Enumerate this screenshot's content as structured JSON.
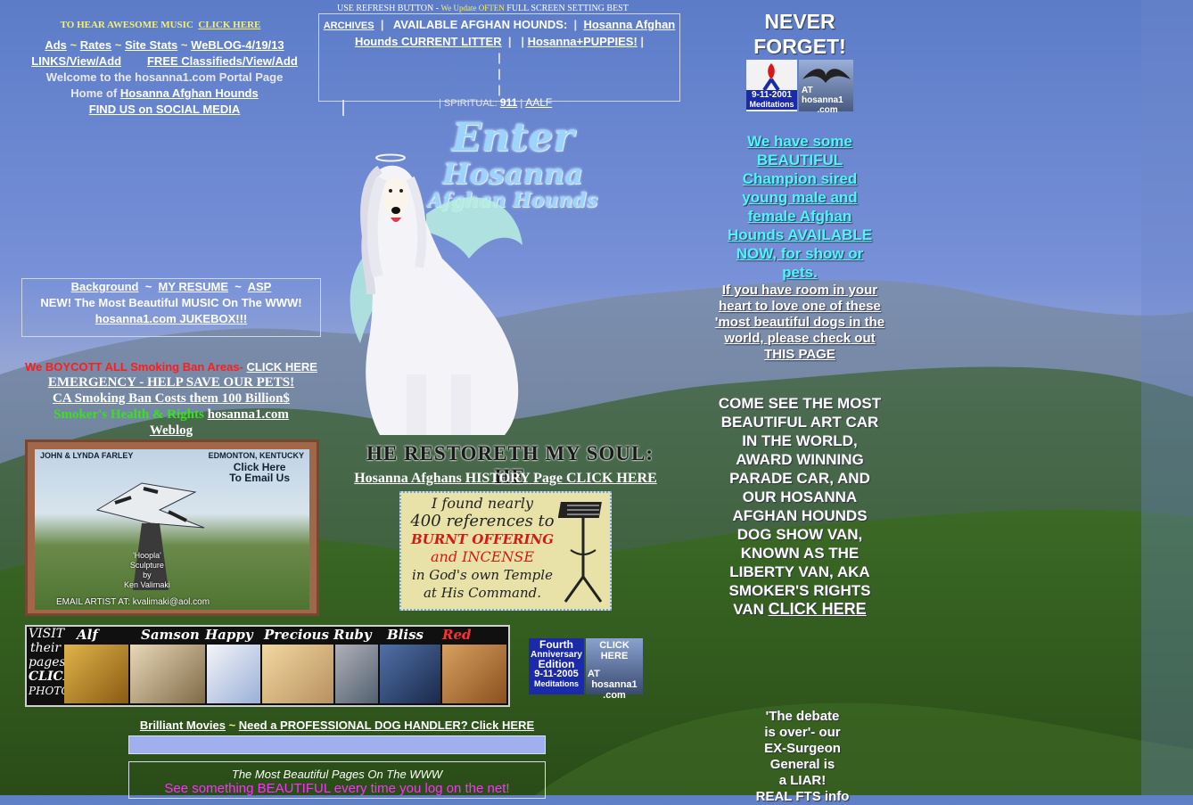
{
  "top": {
    "refresh_notice": "USE  REFRESH BUTTON -",
    "refresh_update": "We Update OFTEN",
    "refresh_tail": "FULL SCREEN SETTING BEST",
    "music_prompt": "TO HEAR AWESOME MUSIC",
    "music_link": "CLICK HERE"
  },
  "left_nav": {
    "ads": "Ads",
    "rates": "Rates",
    "site_stats": "Site Stats",
    "weblog": "WeBLOG-4/19/13",
    "links": "LINKS/View/Add",
    "classifieds": "FREE Classifieds/View/Add",
    "welcome": "Welcome to the hosanna1.com Portal Page",
    "home_of": "Home of",
    "home_link": "Hosanna Afghan Hounds",
    "social": "FIND US on SOCIAL MEDIA",
    "sep": "~"
  },
  "center_box": {
    "archives": "ARCHIVES",
    "available": "AVAILABLE AFGHAN HOUNDS:",
    "hosanna_current": "Hosanna Afghan Hounds CURRENT LITTER",
    "puppies": "Hosanna+PUPPIES!",
    "spiritual": "SPIRITUAL:",
    "link_911": "911",
    "aalf": "AALF"
  },
  "enter_logo": {
    "line1": "Enter",
    "line2": "Hosanna",
    "line3": "Afghan Hounds"
  },
  "restoreth": "HE RESTORETH MY SOUL: HE",
  "history_link": "Hosanna Afghans HISTORY Page CLICK HERE",
  "burnt_offering": {
    "l1": "I found nearly",
    "l2": "400 references to",
    "l3": "BURNT OFFERING",
    "l4": "and INCENSE",
    "l5": "in God's own Temple",
    "l6": "at His Command."
  },
  "left_box": {
    "background": "Background",
    "resume": "MY RESUME",
    "asp": "ASP",
    "music": "NEW! The Most Beautiful MUSIC On The WWW!",
    "jukebox": "hosanna1.com JUKEBOX!!!"
  },
  "boycott": {
    "text": "We BOYCOTT ALL Smoking Ban Areas-",
    "link": "CLICK HERE",
    "emergency": "EMERGENCY - HELP SAVE OUR PETS!",
    "ca_ban": "CA Smoking Ban Costs them 100 Billion$",
    "smokers": "Smoker's Health & Rights",
    "hosanna_link": "hosanna1.com",
    "weblog": "Weblog"
  },
  "farley_card": {
    "names": "JOHN & LYNDA FARLEY",
    "location": "EDMONTON, KENTUCKY",
    "click": "Click Here",
    "email": "To Email Us",
    "hoopla": "'Hoopla'",
    "sculpture": "Sculpture",
    "by": "by",
    "artist": "Ken Valimaki",
    "email_artist": "EMAIL ARTIST AT:  kvalimaki@aol.com"
  },
  "dog_strip": {
    "visit": "VISIT",
    "their": "their",
    "pages": "pages",
    "click": "CLICK",
    "photos": "PHOTOS",
    "names": [
      "Alf",
      "Samson",
      "Happy",
      "Precious",
      "Ruby",
      "Bliss",
      "Red Man"
    ]
  },
  "anniversary": {
    "l1": "Fourth",
    "l2": "Anniversary",
    "l3": "Edition",
    "l4": "9-11-2005",
    "l5": "Meditations",
    "click": "CLICK HERE",
    "at": "AT",
    "site": "hosanna1",
    "com": ".com"
  },
  "bottom": {
    "movies": "Brilliant Movies",
    "handler": "Need a PROFESSIONAL DOG HANDLER? Click HERE",
    "sep": "~",
    "most_beautiful": "The Most Beautiful Pages On The WWW",
    "see_something": "See something BEAUTIFUL every time you log on the net!"
  },
  "right": {
    "never": "NEVER",
    "forget": "FORGET!",
    "badge_date": "9-11-2001",
    "badge_med": "Meditations",
    "badge_at": "AT",
    "badge_site": "hosanna1",
    "badge_com": ".com",
    "champion": "We have some BEAUTIFUL Champion sired young male and female Afghan Hounds AVAILABLE NOW, for show or pets.",
    "room": "If you have room in your heart to love one of these 'most beautiful dogs in the world, please check out",
    "this_page": "THIS PAGE",
    "art_car": "COME SEE THE MOST BEAUTIFUL ART CAR IN THE WORLD, AWARD WINNING PARADE CAR, AND OUR HOSANNA AFGHAN HOUNDS DOG SHOW VAN, KNOWN AS THE LIBERTY VAN, AKA SMOKER'S RIGHTS VAN",
    "click_here": "CLICK HERE",
    "debate1": "'The debate",
    "debate2": "is over'- our",
    "debate3": "EX-Surgeon",
    "debate4": "General is",
    "debate5": "a LIAR!",
    "debate6": "REAL FTS info"
  },
  "colors": {
    "sky": "#6b86d0",
    "forest": "#2f5a1e",
    "link_yellow": "#f6f06a",
    "alert_red": "#ff1c1c",
    "green": "#37e21d",
    "cyan": "#4ef5ff",
    "magenta": "#ff30ff"
  }
}
